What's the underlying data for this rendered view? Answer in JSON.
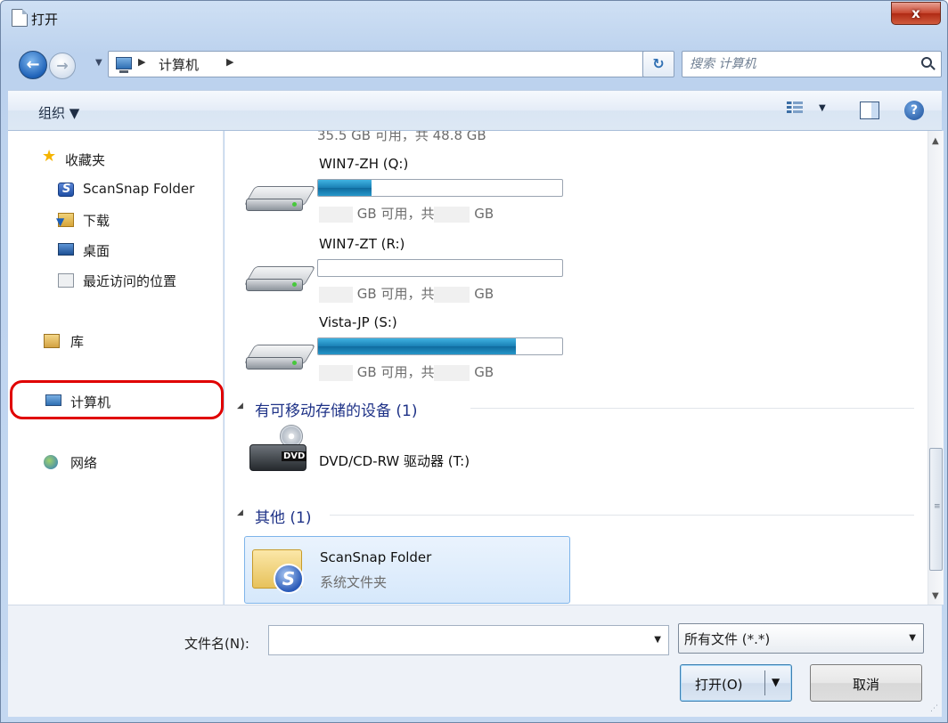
{
  "window": {
    "title": "打开",
    "close_label": "x"
  },
  "nav": {
    "address_segment": "计算机",
    "search_placeholder": "搜索 计算机"
  },
  "toolbar": {
    "organize_label": "组织 ▼"
  },
  "sidebar": {
    "favorites": "收藏夹",
    "scansnap": "ScanSnap Folder",
    "downloads": "下载",
    "desktop": "桌面",
    "recent": "最近访问的位置",
    "libraries": "库",
    "computer": "计算机",
    "network": "网络"
  },
  "content": {
    "partial_top_text": "35.5 GB 可用，共 48.8 GB",
    "drives": [
      {
        "name": "WIN7-ZH (Q:)",
        "fill_percent": 22,
        "space_mid": "GB 可用，共",
        "space_end": "GB"
      },
      {
        "name": "WIN7-ZT (R:)",
        "fill_percent": 0,
        "space_mid": "GB 可用，共",
        "space_end": "GB"
      },
      {
        "name": "Vista-JP (S:)",
        "fill_percent": 81,
        "space_mid": "GB 可用，共",
        "space_end": "GB"
      }
    ],
    "removable_group": "有可移动存储的设备 (1)",
    "dvd_name": "DVD/CD-RW 驱动器 (T:)",
    "dvd_badge": "DVD",
    "other_group": "其他 (1)",
    "folder_name": "ScanSnap Folder",
    "folder_type": "系统文件夹"
  },
  "footer": {
    "filename_label": "文件名(N):",
    "filename_value": "",
    "filetype_value": "所有文件 (*.*)",
    "open_label": "打开(O)",
    "cancel_label": "取消"
  },
  "colors": {
    "accent": "#1e3287",
    "selection": "#d6e8fb",
    "highlight_ring": "#e00000"
  }
}
